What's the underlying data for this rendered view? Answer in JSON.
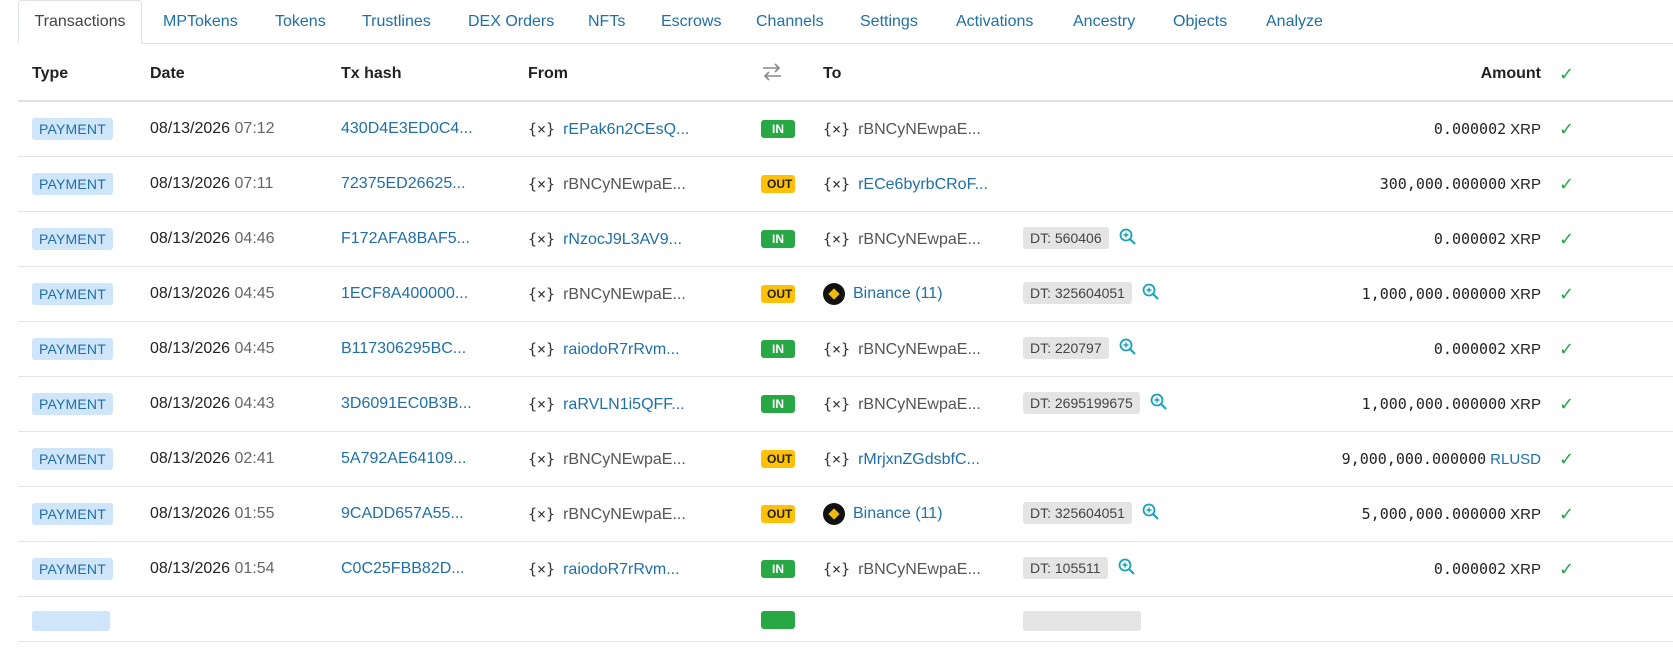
{
  "tabs": [
    "Transactions",
    "MPTokens",
    "Tokens",
    "Trustlines",
    "DEX Orders",
    "NFTs",
    "Escrows",
    "Channels",
    "Settings",
    "Activations",
    "Ancestry",
    "Objects",
    "Analyze"
  ],
  "table": {
    "headers": {
      "type": "Type",
      "date": "Date",
      "hash": "Tx hash",
      "from": "From",
      "direction_icon": "swap-arrows-icon",
      "to": "To",
      "amount": "Amount"
    },
    "rows": [
      {
        "type": "PAYMENT",
        "date": "08/13/2026",
        "time": "07:12",
        "hash": "430D4E3ED0C4...",
        "from": "rEPak6n2CEsQ...",
        "from_link": true,
        "dir": "IN",
        "to": "rBNCyNEwpaE...",
        "to_link": false,
        "to_icon": "xrpl-address-icon",
        "dt": "",
        "amount": "0.000002",
        "currency": "XRP",
        "currency_link": false
      },
      {
        "type": "PAYMENT",
        "date": "08/13/2026",
        "time": "07:11",
        "hash": "72375ED26625...",
        "from": "rBNCyNEwpaE...",
        "from_link": false,
        "dir": "OUT",
        "to": "rECe6byrbCRoF...",
        "to_link": true,
        "to_icon": "xrpl-address-icon",
        "dt": "",
        "amount": "300,000.000000",
        "currency": "XRP",
        "currency_link": false
      },
      {
        "type": "PAYMENT",
        "date": "08/13/2026",
        "time": "04:46",
        "hash": "F172AFA8BAF5...",
        "from": "rNzocJ9L3AV9...",
        "from_link": true,
        "dir": "IN",
        "to": "rBNCyNEwpaE...",
        "to_link": false,
        "to_icon": "xrpl-address-icon",
        "dt": "DT: 560406",
        "amount": "0.000002",
        "currency": "XRP",
        "currency_link": false
      },
      {
        "type": "PAYMENT",
        "date": "08/13/2026",
        "time": "04:45",
        "hash": "1ECF8A400000...",
        "from": "rBNCyNEwpaE...",
        "from_link": false,
        "dir": "OUT",
        "to": "Binance (11)",
        "to_link": true,
        "to_icon": "binance-logo-icon",
        "dt": "DT: 325604051",
        "amount": "1,000,000.000000",
        "currency": "XRP",
        "currency_link": false
      },
      {
        "type": "PAYMENT",
        "date": "08/13/2026",
        "time": "04:45",
        "hash": "B117306295BC...",
        "from": "raiodoR7rRvm...",
        "from_link": true,
        "dir": "IN",
        "to": "rBNCyNEwpaE...",
        "to_link": false,
        "to_icon": "xrpl-address-icon",
        "dt": "DT: 220797",
        "amount": "0.000002",
        "currency": "XRP",
        "currency_link": false
      },
      {
        "type": "PAYMENT",
        "date": "08/13/2026",
        "time": "04:43",
        "hash": "3D6091EC0B3B...",
        "from": "raRVLN1i5QFF...",
        "from_link": true,
        "dir": "IN",
        "to": "rBNCyNEwpaE...",
        "to_link": false,
        "to_icon": "xrpl-address-icon",
        "dt": "DT: 2695199675",
        "amount": "1,000,000.000000",
        "currency": "XRP",
        "currency_link": false
      },
      {
        "type": "PAYMENT",
        "date": "08/13/2026",
        "time": "02:41",
        "hash": "5A792AE64109...",
        "from": "rBNCyNEwpaE...",
        "from_link": false,
        "dir": "OUT",
        "to": "rMrjxnZGdsbfC...",
        "to_link": true,
        "to_icon": "xrpl-address-icon",
        "dt": "",
        "amount": "9,000,000.000000",
        "currency": "RLUSD",
        "currency_link": true
      },
      {
        "type": "PAYMENT",
        "date": "08/13/2026",
        "time": "01:55",
        "hash": "9CADD657A55...",
        "from": "rBNCyNEwpaE...",
        "from_link": false,
        "dir": "OUT",
        "to": "Binance (11)",
        "to_link": true,
        "to_icon": "binance-logo-icon",
        "dt": "DT: 325604051",
        "amount": "5,000,000.000000",
        "currency": "XRP",
        "currency_link": false
      },
      {
        "type": "PAYMENT",
        "date": "08/13/2026",
        "time": "01:54",
        "hash": "C0C25FBB82D...",
        "from": "raiodoR7rRvm...",
        "from_link": true,
        "dir": "IN",
        "to": "rBNCyNEwpaE...",
        "to_link": false,
        "to_icon": "xrpl-address-icon",
        "dt": "DT: 105511",
        "amount": "0.000002",
        "currency": "XRP",
        "currency_link": false
      }
    ]
  },
  "colors": {
    "link": "#1f6fa6",
    "in_badge": "#28a745",
    "out_badge": "#ffc107",
    "type_badge": "#cfe5fa",
    "check": "#28a745"
  },
  "icons": {
    "success": "checkmark-icon",
    "zoom": "magnifier-plus-icon",
    "address": "xrpl-address-icon"
  }
}
